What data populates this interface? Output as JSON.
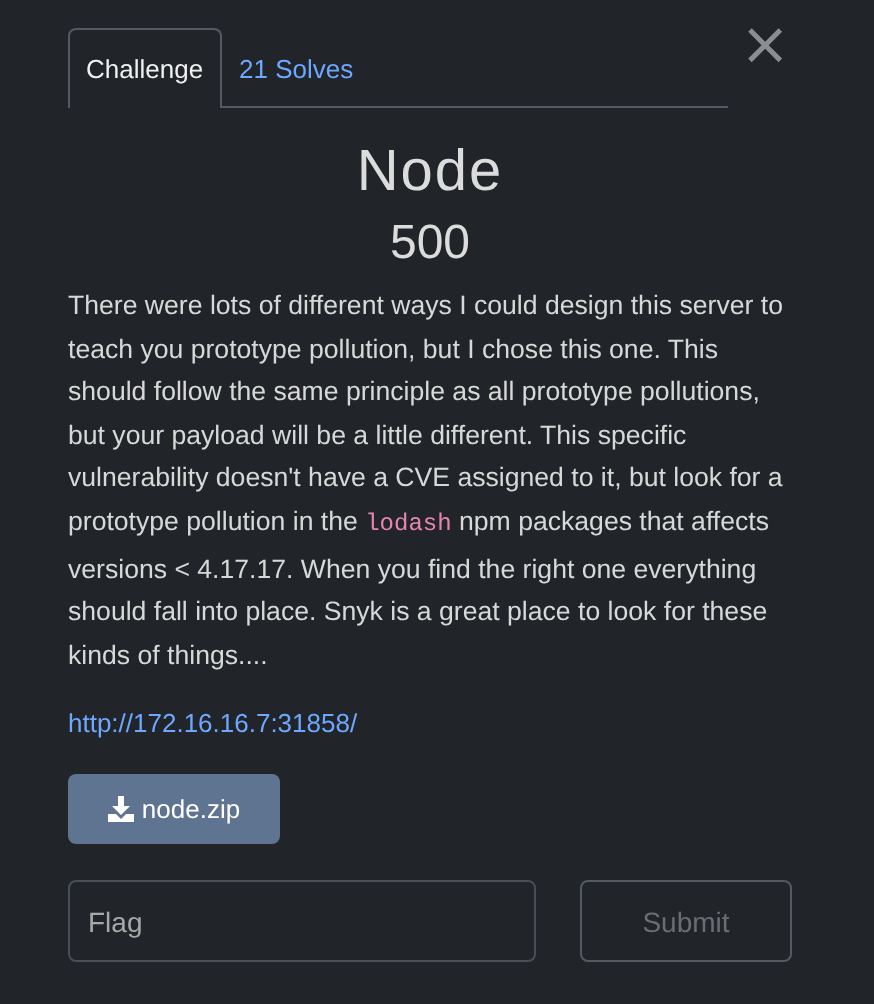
{
  "tabs": [
    {
      "label": "Challenge",
      "selected": true
    },
    {
      "label": "21 Solves",
      "selected": false
    }
  ],
  "close": "×",
  "title": "Node",
  "points": "500",
  "description": {
    "before": "There were lots of different ways I could design this server to teach you prototype pollution, but I chose this one. This should follow the same principle as all prototype pollutions, but your payload will be a little different. This specific vulnerability doesn't have a CVE assigned to it, but look for a prototype pollution in the ",
    "code": "lodash",
    "after": " npm packages that affects versions < 4.17.17. When you find the right one everything should fall into place. Snyk is a great place to look for these kinds of things...."
  },
  "link": "http://172.16.16.7:31858/",
  "file": "node.zip",
  "flag": {
    "placeholder": "Flag"
  },
  "submit": "Submit"
}
